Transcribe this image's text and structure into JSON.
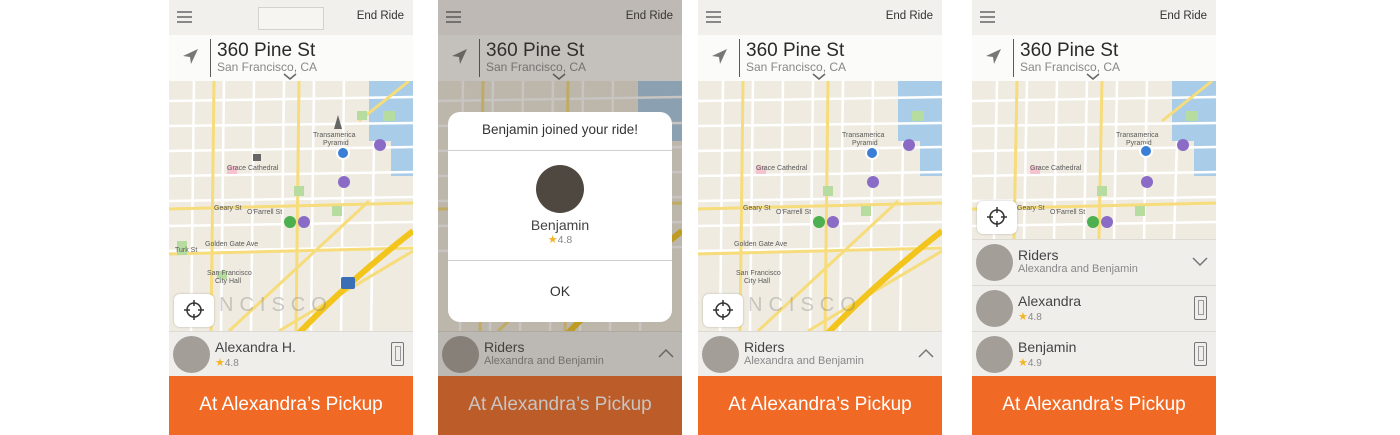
{
  "common": {
    "end_ride": "End Ride",
    "street": "360 Pine St",
    "city": "San Francisco, CA",
    "footer": "At Alexandra’s Pickup",
    "map_labels": {
      "transamerica": "Transamerica",
      "pyramid": "Pyramid",
      "grace": "Grace Cathedral",
      "geary": "Geary St",
      "ofarrell": "O'Farrell St",
      "hyde": "Hyde St",
      "larkin": "Larkin St",
      "golden": "Golden Gate Ave",
      "turk": "Turk St",
      "market": "Market St",
      "cityhall1": "San Francisco",
      "cityhall2": "City Hall",
      "franklin": "Franklin St",
      "bigword": "NCISCO",
      "hwy": "80"
    }
  },
  "screen1": {
    "rider": {
      "name": "Alexandra H.",
      "rating": "4.8"
    }
  },
  "screen2": {
    "dialog": {
      "title": "Benjamin joined your ride!",
      "name": "Benjamin",
      "rating": "4.8",
      "ok": "OK"
    },
    "riders": {
      "title": "Riders",
      "sub": "Alexandra and Benjamin"
    }
  },
  "screen3": {
    "riders": {
      "title": "Riders",
      "sub": "Alexandra and Benjamin"
    }
  },
  "screen4": {
    "riders": {
      "title": "Riders",
      "sub": "Alexandra and Benjamin"
    },
    "rider_list": [
      {
        "name": "Alexandra",
        "rating": "4.8"
      },
      {
        "name": "Benjamin",
        "rating": "4.9"
      }
    ]
  },
  "colors": {
    "accent": "#f06a26",
    "marker_blue": "#3a7fd5",
    "marker_green": "#4caf50",
    "transit_purple": "#8a6cc7"
  },
  "icons": [
    "menu-icon",
    "navigation-arrow-icon",
    "chevron-down-icon",
    "crosshair-icon",
    "phone-icon",
    "chevron-up-icon",
    "star-icon"
  ]
}
